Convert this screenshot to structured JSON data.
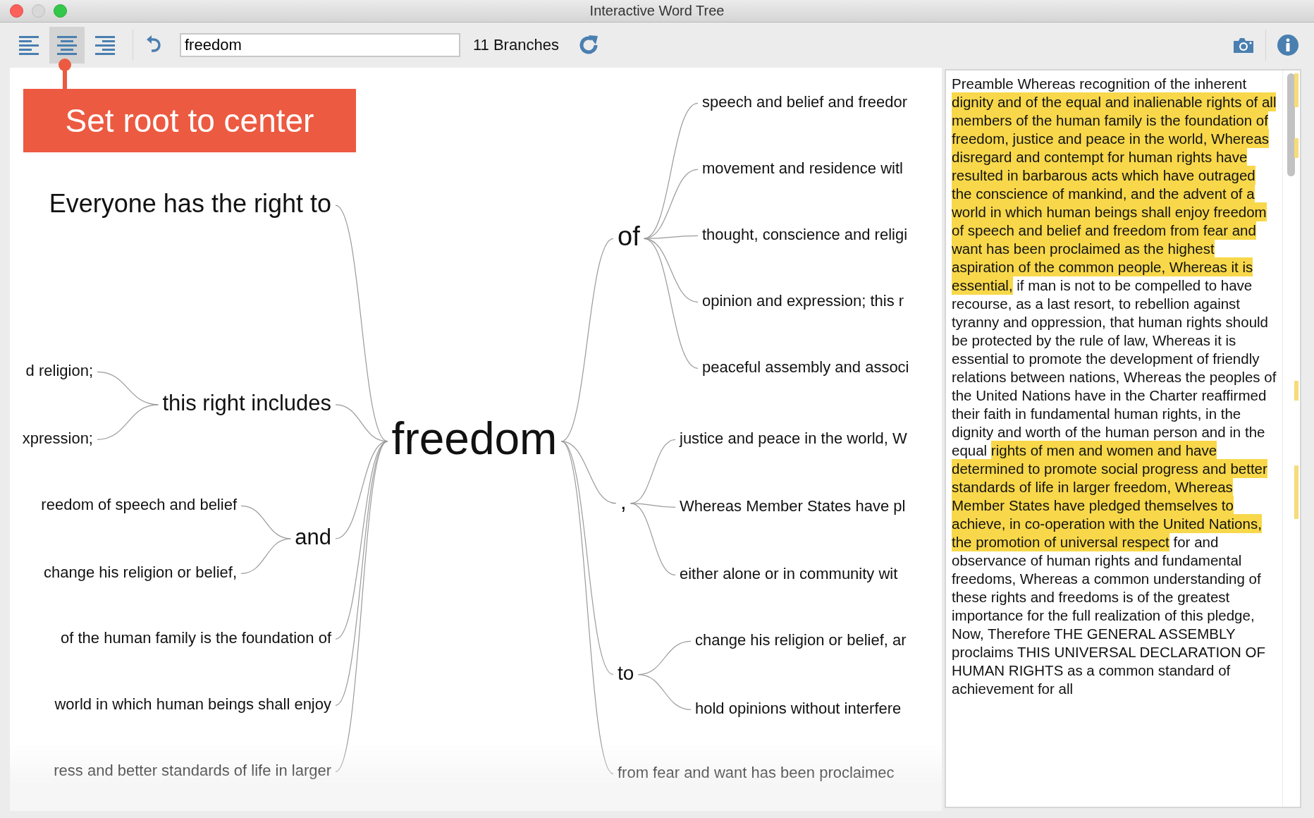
{
  "window": {
    "title": "Interactive Word Tree"
  },
  "toolbar": {
    "align_buttons": [
      {
        "kind": "left",
        "selected": false
      },
      {
        "kind": "center",
        "selected": true
      },
      {
        "kind": "right",
        "selected": false
      }
    ],
    "search": {
      "value": "freedom"
    },
    "branch_count": "11 Branches"
  },
  "callout": {
    "text": "Set root to center"
  },
  "tree": {
    "root": "freedom",
    "left": [
      {
        "text": "Everyone has the right to"
      },
      {
        "text": "this right includes",
        "children": [
          {
            "text": "d religion;"
          },
          {
            "text": "xpression;"
          }
        ]
      },
      {
        "text": "and",
        "children": [
          {
            "text": "reedom of speech and belief"
          },
          {
            "text": "change his religion or belief,"
          }
        ]
      },
      {
        "text": "of the human family is the foundation of"
      },
      {
        "text": "world in which human beings shall enjoy"
      },
      {
        "text": "ress and better standards of life in larger"
      }
    ],
    "right": [
      {
        "text": "of",
        "children": [
          {
            "text": "speech and belief and freedor"
          },
          {
            "text": "movement and residence witl"
          },
          {
            "text": "thought, conscience and religi"
          },
          {
            "text": "opinion and expression; this r"
          },
          {
            "text": "peaceful assembly and associ"
          }
        ]
      },
      {
        "text": ",",
        "children": [
          {
            "text": "justice and peace in the world, W"
          },
          {
            "text": "Whereas Member States have pl"
          },
          {
            "text": "either alone or in community wit"
          }
        ]
      },
      {
        "text": "to",
        "children": [
          {
            "text": "change his religion or belief, ar"
          },
          {
            "text": "hold opinions without interfere"
          }
        ]
      },
      {
        "text": "from fear and want has been proclaimec"
      }
    ]
  },
  "text_panel": {
    "segments": [
      {
        "text": "Preamble Whereas recognition of the inherent ",
        "highlighted": false
      },
      {
        "text": "dignity and of the equal and inalienable rights of all members of the human family is the foundation of freedom, justice and peace in the world, Whereas disregard and contempt for human rights have resulted in barbarous acts which have outraged the conscience of mankind, and the advent of a world in which human beings shall enjoy freedom of speech and belief and freedom from fear and want has been proclaimed as the highest aspiration of the common people, Whereas it is essential,",
        "highlighted": true
      },
      {
        "text": " if man is not to be compelled to have recourse, as a last resort, to rebellion against tyranny and oppression, that human rights should be protected by the rule of law, Whereas it is essential to promote the development of friendly relations between nations, Whereas the peoples of the United Nations have in the Charter reaffirmed their faith in fundamental human rights, in the dignity and worth of the human person and in the equal ",
        "highlighted": false
      },
      {
        "text": "rights of men and women and have determined to promote social progress and better standards of life in larger freedom, Whereas Member States have pledged themselves to achieve, in co-operation with the United Nations, the promotion of universal respect",
        "highlighted": true
      },
      {
        "text": " for and observance of human rights and fundamental freedoms, Whereas a common understanding of these rights and freedoms is of the greatest importance for the full realization of this pledge, Now, Therefore THE GENERAL ASSEMBLY proclaims THIS UNIVERSAL DECLARATION OF HUMAN RIGHTS as a common standard of achievement for all",
        "highlighted": false
      }
    ]
  }
}
